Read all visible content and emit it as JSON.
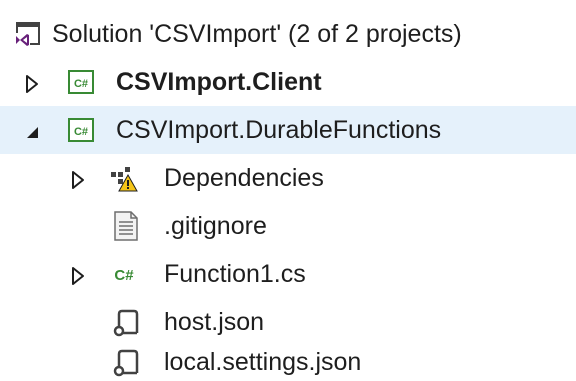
{
  "solution_explorer": {
    "solution": {
      "label": "Solution 'CSVImport' (2 of 2 projects)",
      "icon": "visual-studio-solution-icon"
    },
    "projects": [
      {
        "label": "CSVImport.Client",
        "icon": "csharp-project-icon",
        "expanded": false,
        "bold": true
      },
      {
        "label": "CSVImport.DurableFunctions",
        "icon": "csharp-project-icon",
        "expanded": true,
        "selected": true,
        "children": [
          {
            "label": "Dependencies",
            "icon": "dependencies-warning-icon",
            "expandable": true
          },
          {
            "label": ".gitignore",
            "icon": "text-file-icon"
          },
          {
            "label": "Function1.cs",
            "icon": "csharp-file-icon",
            "expandable": true
          },
          {
            "label": "host.json",
            "icon": "json-file-icon"
          },
          {
            "label": "local.settings.json",
            "icon": "json-file-icon"
          }
        ]
      }
    ]
  },
  "colors": {
    "selection_background": "#e5f1fb",
    "text": "#1e1e1e",
    "csharp_green": "#388a34",
    "solution_purple": "#68217a",
    "warning_yellow": "#f5c518"
  }
}
